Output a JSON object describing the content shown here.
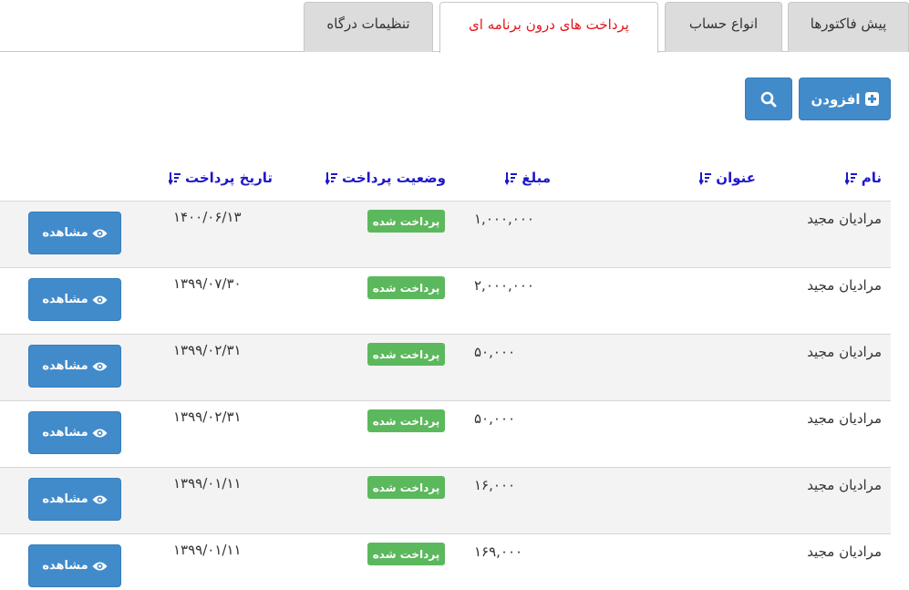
{
  "tabs": [
    {
      "label": "پیش فاکتورها",
      "active": false
    },
    {
      "label": "انواع حساب",
      "active": false
    },
    {
      "label": "پرداخت های درون برنامه ای",
      "active": true
    },
    {
      "label": "تنظیمات درگاه",
      "active": false
    }
  ],
  "toolbar": {
    "add_label": "افزودن",
    "add_icon": "plus-square-icon",
    "search_icon": "search-icon"
  },
  "table": {
    "headers": {
      "name": "نام",
      "title": "عنوان",
      "amount": "مبلغ",
      "status": "وضعیت پرداخت",
      "date": "تاریخ پرداخت"
    },
    "sort_icon": "sort-amount-icon",
    "view_label": "مشاهده",
    "view_icon": "eye-icon",
    "rows": [
      {
        "name": "مرادیان مجید",
        "title": "",
        "amount": "۱,۰۰۰,۰۰۰",
        "status": "پرداخت شده",
        "date": "۱۴۰۰/۰۶/۱۳"
      },
      {
        "name": "مرادیان مجید",
        "title": "",
        "amount": "۲,۰۰۰,۰۰۰",
        "status": "پرداخت شده",
        "date": "۱۳۹۹/۰۷/۳۰"
      },
      {
        "name": "مرادیان مجید",
        "title": "",
        "amount": "۵۰,۰۰۰",
        "status": "پرداخت شده",
        "date": "۱۳۹۹/۰۲/۳۱"
      },
      {
        "name": "مرادیان مجید",
        "title": "",
        "amount": "۵۰,۰۰۰",
        "status": "پرداخت شده",
        "date": "۱۳۹۹/۰۲/۳۱"
      },
      {
        "name": "مرادیان مجید",
        "title": "",
        "amount": "۱۶,۰۰۰",
        "status": "پرداخت شده",
        "date": "۱۳۹۹/۰۱/۱۱"
      },
      {
        "name": "مرادیان مجید",
        "title": "",
        "amount": "۱۶۹,۰۰۰",
        "status": "پرداخت شده",
        "date": "۱۳۹۹/۰۱/۱۱"
      }
    ]
  },
  "colors": {
    "primary": "#428bca",
    "success": "#5cb85c",
    "header_link": "#1f18c9",
    "active_tab": "#e4141b"
  }
}
